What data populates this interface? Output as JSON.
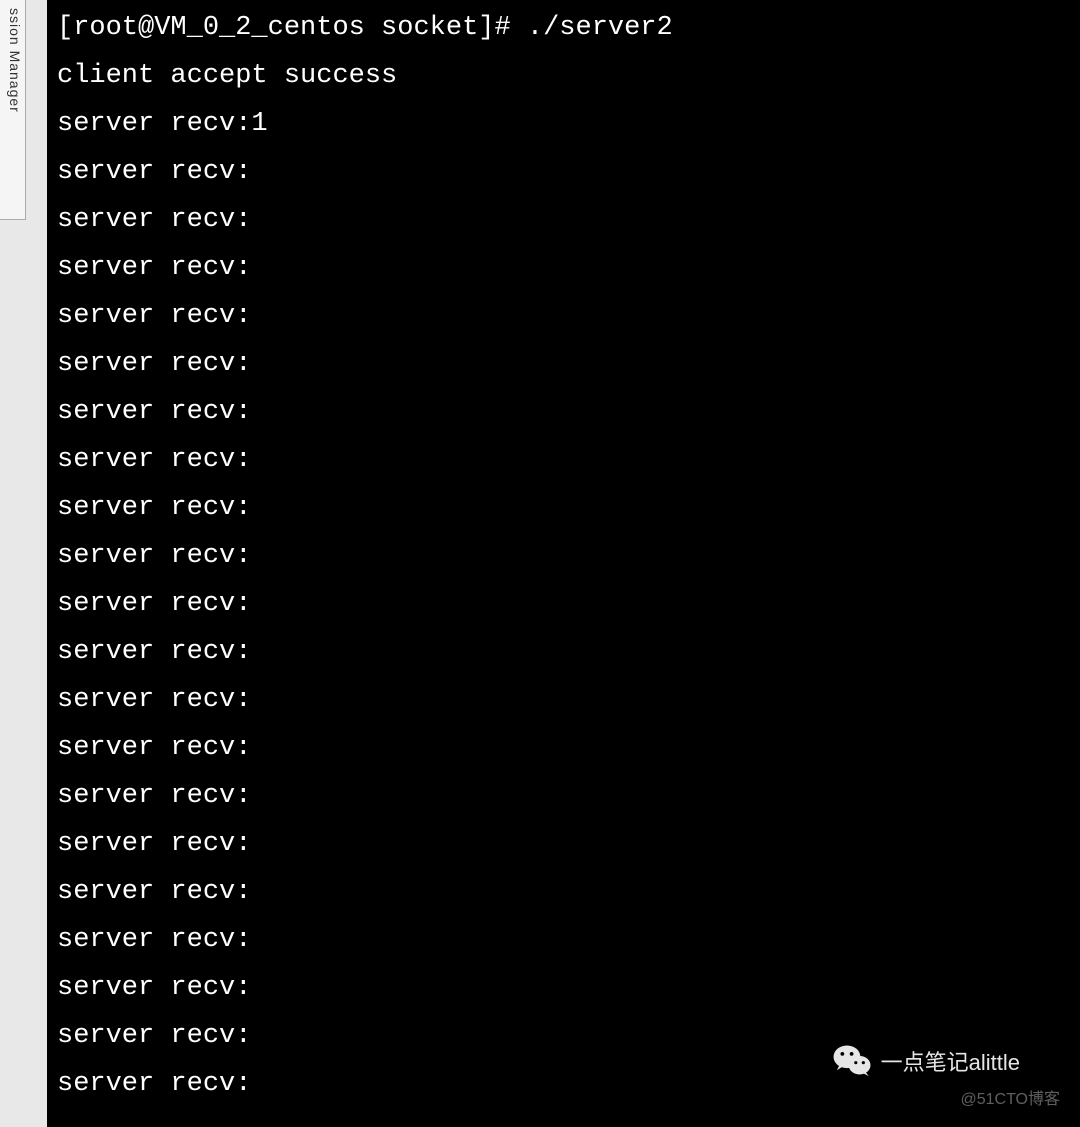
{
  "sidebar": {
    "label": "ssion Manager"
  },
  "terminal": {
    "prompt": "[root@VM_0_2_centos socket]# ",
    "command": "./server2",
    "lines": [
      "client accept success",
      "server recv:1",
      "server recv:",
      "server recv:",
      "server recv:",
      "server recv:",
      "server recv:",
      "server recv:",
      "server recv:",
      "server recv:",
      "server recv:",
      "server recv:",
      "server recv:",
      "server recv:",
      "server recv:",
      "server recv:",
      "server recv:",
      "server recv:",
      "server recv:",
      "server recv:",
      "server recv:",
      "server recv:"
    ]
  },
  "watermark": {
    "main": "一点笔记alittle",
    "sub": "@51CTO博客"
  }
}
